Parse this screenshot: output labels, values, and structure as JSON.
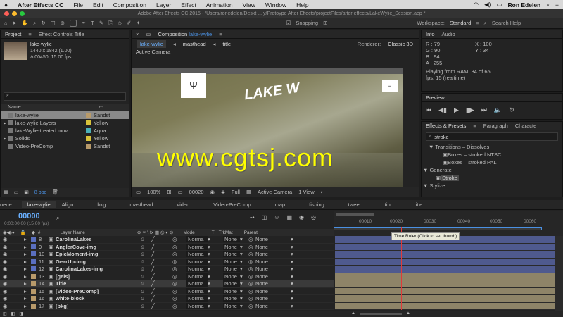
{
  "menubar": {
    "apple": "",
    "app": "After Effects CC",
    "items": [
      "File",
      "Edit",
      "Composition",
      "Layer",
      "Effect",
      "Animation",
      "View",
      "Window",
      "Help"
    ],
    "user": "Ron Edelen"
  },
  "window": {
    "title": "Adobe After Effects CC 2015 - /Users/ronedelen/Deskt ... y/Protoype After Effects/projectFiles/after effects/LakeWylie_Session.aep *"
  },
  "toolbar": {
    "snapping": "Snapping",
    "workspace_label": "Workspace:",
    "workspace_value": "Standard",
    "search": "Search Help"
  },
  "project": {
    "tab": "Project",
    "tab2": "Effect Controls Title",
    "item_name": "lake-wylie",
    "item_dims": "1440 x 1842 (1.00)",
    "item_dur": "Δ 00450, 15.00 fps",
    "col_name": "Name",
    "items": [
      {
        "name": "lake-wylie",
        "label": "Sandst",
        "color": "#b89a6a"
      },
      {
        "name": "lake-wylie Layers",
        "label": "Yellow",
        "color": "#d8c23a"
      },
      {
        "name": "lakeWylie-treated.mov",
        "label": "Aqua",
        "color": "#4ab0b8"
      },
      {
        "name": "Solids",
        "label": "Yellow",
        "color": "#d8c23a"
      },
      {
        "name": "Video-PreComp",
        "label": "Sandst",
        "color": "#b89a6a"
      }
    ],
    "bpc": "8 bpc"
  },
  "composition": {
    "tab": "Composition",
    "tab_name": "lake-wylie",
    "breadcrumbs": [
      "lake-wylie",
      "masthead",
      "title"
    ],
    "renderer_label": "Renderer:",
    "renderer": "Classic 3D",
    "camera_label": "Active Camera",
    "logo_text": "LAKE W",
    "zoom": "100%",
    "frame": "00020",
    "resolution": "Full",
    "camera": "Active Camera",
    "views": "1 View"
  },
  "watermark": "www.cgtsj.com",
  "info": {
    "tab": "Info",
    "tab2": "Audio",
    "r": "R : 79",
    "g": "G : 90",
    "b": "B : 94",
    "a": "A : 255",
    "x": "X : 100",
    "y": "Y : 34",
    "playing": "Playing from RAM: 34 of 65",
    "fps": "fps: 15 (realtime)"
  },
  "preview": {
    "tab": "Preview"
  },
  "effects": {
    "tab": "Effects & Presets",
    "tab2": "Paragraph",
    "tab3": "Characte",
    "search": "stroke",
    "rows": [
      {
        "text": "▼ Transitions – Dissolves",
        "indent": 10
      },
      {
        "text": "Boxes – stroked NTSC",
        "indent": 30
      },
      {
        "text": "Boxes – stroked PAL",
        "indent": 30
      },
      {
        "text": "▼ Generate",
        "indent": 0
      },
      {
        "text": "Stroke",
        "indent": 30
      },
      {
        "text": "▼ Stylize",
        "indent": 0
      }
    ]
  },
  "timeline": {
    "tabs": [
      "ueue",
      "lake-wylie",
      "Align",
      "bkg",
      "masthead",
      "video",
      "Video-PreComp",
      "map",
      "fishing",
      "tweet",
      "tip",
      "title"
    ],
    "timecode": "00000",
    "timecode_sub": "0:00:00:00 (15.00 fps)",
    "col_layer": "Layer Name",
    "col_mode": "Mode",
    "col_t": "T",
    "col_trkmat": "TrkMat",
    "col_parent": "Parent",
    "ruler": [
      "00010",
      "00020",
      "00030",
      "00040",
      "00050",
      "00060"
    ],
    "tooltip": "Time Ruler (Click to set thumb)",
    "layers": [
      {
        "num": "8",
        "name": "CarolinaLakes",
        "color": "#5a6fc0"
      },
      {
        "num": "9",
        "name": "AnglerCove-img",
        "color": "#5a6fc0"
      },
      {
        "num": "10",
        "name": "EpicMoment-img",
        "color": "#5a6fc0"
      },
      {
        "num": "11",
        "name": "GearUp-img",
        "color": "#5a6fc0"
      },
      {
        "num": "12",
        "name": "CarolinaLakes-img",
        "color": "#5a6fc0"
      },
      {
        "num": "13",
        "name": "[gels]",
        "color": "#b89a6a"
      },
      {
        "num": "14",
        "name": "Title",
        "color": "#b89a6a"
      },
      {
        "num": "15",
        "name": "[Video-PreComp]",
        "color": "#b89a6a"
      },
      {
        "num": "16",
        "name": "white-block",
        "color": "#b89a6a"
      },
      {
        "num": "17",
        "name": "[bkg]",
        "color": "#b89a6a"
      }
    ],
    "mode": "Norma",
    "none": "None"
  },
  "colors": {
    "accent": "#4a90e2",
    "track_blue": "#4f5a8e",
    "track_tan": "#8e8468",
    "playhead": "#e03a3a"
  }
}
